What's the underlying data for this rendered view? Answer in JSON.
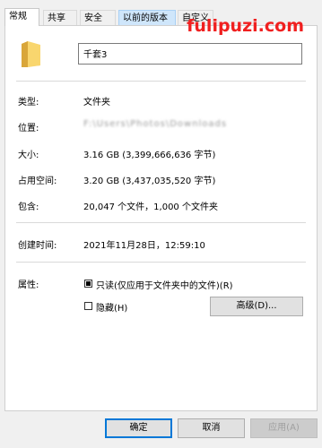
{
  "tabs": [
    {
      "label": "常规"
    },
    {
      "label": "共享"
    },
    {
      "label": "安全"
    },
    {
      "label": "以前的版本"
    },
    {
      "label": "自定义"
    }
  ],
  "watermark": "fulipuzi.com",
  "folder_name": "千套3",
  "properties": {
    "type_label": "类型:",
    "type_value": "文件夹",
    "location_label": "位置:",
    "location_value": "F:\\Users\\Photos\\Downloads",
    "size_label": "大小:",
    "size_value": "3.16 GB (3,399,666,636 字节)",
    "disk_label": "占用空间:",
    "disk_value": "3.20 GB (3,437,035,520 字节)",
    "contains_label": "包含:",
    "contains_value": "20,047 个文件，1,000 个文件夹",
    "created_label": "创建时间:",
    "created_value": "2021年11月28日，12:59:10",
    "attributes_label": "属性:",
    "readonly_label": "只读(仅应用于文件夹中的文件)(R)",
    "hidden_label": "隐藏(H)",
    "advanced_label": "高级(D)..."
  },
  "footer": {
    "ok": "确定",
    "cancel": "取消",
    "apply": "应用(A)"
  },
  "colors": {
    "watermark": "#f02020",
    "accent": "#0078d7"
  }
}
